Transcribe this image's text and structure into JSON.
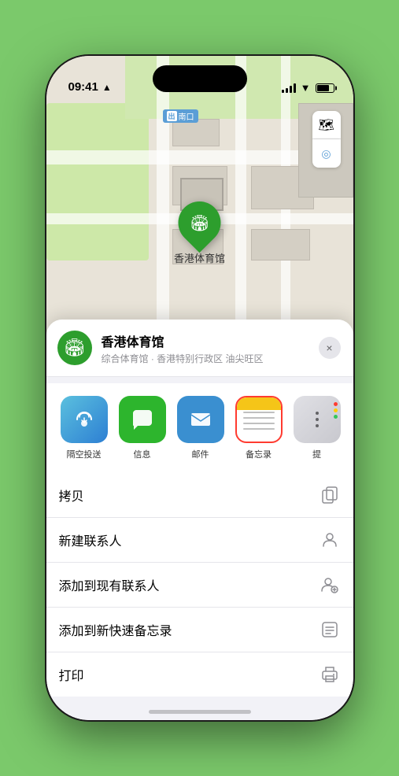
{
  "status_bar": {
    "time": "09:41",
    "navigation_arrow": "▲"
  },
  "map": {
    "label_text": "南口",
    "label_prefix": "出",
    "controls": {
      "map_icon": "🗺",
      "location_icon": "◎"
    }
  },
  "marker": {
    "label": "香港体育馆",
    "icon": "🏟"
  },
  "location_header": {
    "name": "香港体育馆",
    "subtitle": "综合体育馆 · 香港特别行政区 油尖旺区",
    "icon": "🏟"
  },
  "share_items": [
    {
      "id": "airdrop",
      "label": "隔空投送",
      "type": "airdrop"
    },
    {
      "id": "message",
      "label": "信息",
      "type": "message"
    },
    {
      "id": "mail",
      "label": "邮件",
      "type": "mail"
    },
    {
      "id": "notes",
      "label": "备忘录",
      "type": "notes",
      "selected": true
    },
    {
      "id": "more",
      "label": "提",
      "type": "more"
    }
  ],
  "actions": [
    {
      "id": "copy",
      "label": "拷贝",
      "icon": "copy"
    },
    {
      "id": "new-contact",
      "label": "新建联系人",
      "icon": "person"
    },
    {
      "id": "add-contact",
      "label": "添加到现有联系人",
      "icon": "person-add"
    },
    {
      "id": "quick-note",
      "label": "添加到新快速备忘录",
      "icon": "note"
    },
    {
      "id": "print",
      "label": "打印",
      "icon": "print"
    }
  ],
  "close_button": "×"
}
